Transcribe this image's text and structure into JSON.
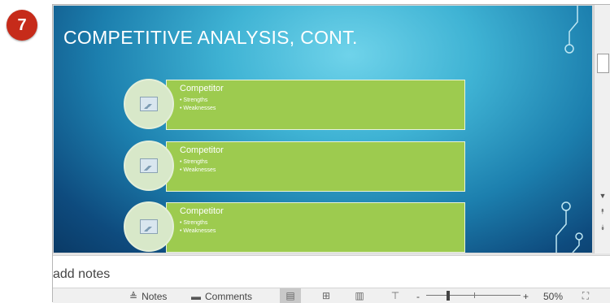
{
  "step": {
    "number": "7"
  },
  "slide": {
    "title": "COMPETITIVE ANALYSIS, CONT.",
    "competitors": [
      {
        "heading": "Competitor",
        "bullets": [
          "Strengths",
          "Weaknesses"
        ]
      },
      {
        "heading": "Competitor",
        "bullets": [
          "Strengths",
          "Weaknesses"
        ]
      },
      {
        "heading": "Competitor",
        "bullets": [
          "Strengths",
          "Weaknesses"
        ]
      }
    ]
  },
  "notes": {
    "placeholder": "add notes"
  },
  "status_bar": {
    "notes_label": "Notes",
    "comments_label": "Comments",
    "zoom_minus": "-",
    "zoom_plus": "+",
    "zoom_level": "50%"
  },
  "colors": {
    "badge": "#c62b1a",
    "slide_background": "#1c7fae",
    "competitor_box": "#9dcb4f",
    "competitor_circle": "#d8e8c9"
  },
  "icons": [
    "notes-icon",
    "comments-icon",
    "normal-view-icon",
    "slide-sorter-icon",
    "reading-view-icon",
    "slideshow-icon",
    "fit-to-window-icon",
    "picture-placeholder-icon"
  ]
}
